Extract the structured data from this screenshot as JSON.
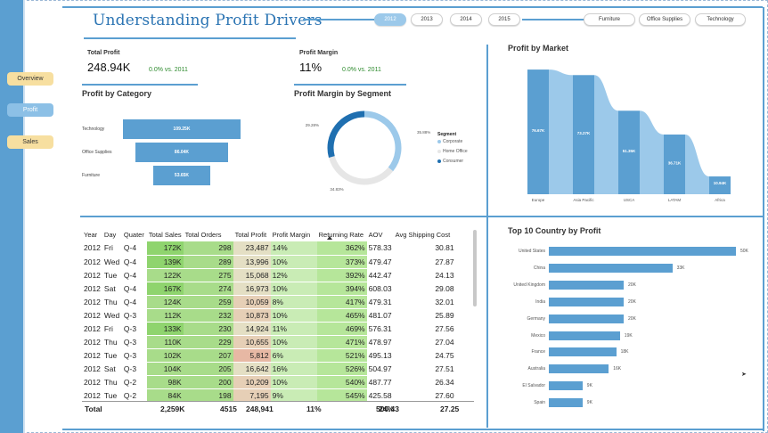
{
  "nav": {
    "overview": "Overview",
    "profit": "Profit",
    "sales": "Sales"
  },
  "title": "Understanding  Profit Drivers",
  "year_filters": [
    "2012",
    "2013",
    "2014",
    "2015"
  ],
  "year_active": "2012",
  "category_filters": [
    "Furniture",
    "Office Supplies",
    "Technology"
  ],
  "kpi": {
    "total_profit_label": "Total Profit",
    "total_profit_value": "248.94K",
    "total_profit_delta": "0.0% vs. 2011",
    "profit_margin_label": "Profit Margin",
    "profit_margin_value": "11%",
    "profit_margin_delta": "0.0% vs. 2011"
  },
  "colors": {
    "accent": "#5b9fd1",
    "accent_light": "#9cc9ea",
    "home_office": "#e6e6e6",
    "consumer": "#1f6fb0"
  },
  "profit_by_category": {
    "title": "Profit by Category",
    "items": [
      {
        "label": "Technology",
        "value": "109.25K",
        "num": 109.25
      },
      {
        "label": "Office Supplies",
        "value": "86.04K",
        "num": 86.04
      },
      {
        "label": "Furniture",
        "value": "53.65K",
        "num": 53.65
      }
    ]
  },
  "profit_margin_by_segment": {
    "title": "Profit Margin by Segment",
    "legend_title": "Segment",
    "segments": [
      {
        "label": "Corporate",
        "value": "35.88%",
        "num": 35.88
      },
      {
        "label": "Home Office",
        "value": "34.83%",
        "num": 34.83
      },
      {
        "label": "Consumer",
        "value": "29.28%",
        "num": 29.28
      }
    ]
  },
  "profit_by_market": {
    "title": "Profit by Market",
    "markets": [
      {
        "label": "Europe",
        "value": "76.67K",
        "num": 76.67
      },
      {
        "label": "Asia Pacific",
        "value": "73.27K",
        "num": 73.27
      },
      {
        "label": "USCA",
        "value": "51.35K",
        "num": 51.35
      },
      {
        "label": "LATAM",
        "value": "36.71K",
        "num": 36.71
      },
      {
        "label": "Africa",
        "value": "10.94K",
        "num": 10.94
      }
    ]
  },
  "top_countries": {
    "title": "Top 10 Country by Profit",
    "countries": [
      {
        "label": "United States",
        "value": "50K",
        "num": 50
      },
      {
        "label": "China",
        "value": "33K",
        "num": 33
      },
      {
        "label": "United Kingdom",
        "value": "20K",
        "num": 20
      },
      {
        "label": "India",
        "value": "20K",
        "num": 20
      },
      {
        "label": "Germany",
        "value": "20K",
        "num": 20
      },
      {
        "label": "Mexico",
        "value": "19K",
        "num": 19
      },
      {
        "label": "France",
        "value": "18K",
        "num": 18
      },
      {
        "label": "Australia",
        "value": "16K",
        "num": 16
      },
      {
        "label": "El Salvador",
        "value": "9K",
        "num": 9
      },
      {
        "label": "Spain",
        "value": "9K",
        "num": 9
      }
    ]
  },
  "table": {
    "headers": [
      "Year",
      "Day",
      "Quater",
      "Total Sales",
      "Total Orders",
      "Total Profit",
      "Profit Margin",
      "Returning Rate",
      "AOV",
      "Avg Shipping Cost"
    ],
    "rows": [
      [
        "2012",
        "Fri",
        "Q-4",
        "172K",
        "298",
        "23,487",
        "14%",
        "362%",
        "578.33",
        "30.81"
      ],
      [
        "2012",
        "Wed",
        "Q-4",
        "139K",
        "289",
        "13,996",
        "10%",
        "373%",
        "479.47",
        "27.87"
      ],
      [
        "2012",
        "Tue",
        "Q-4",
        "122K",
        "275",
        "15,068",
        "12%",
        "392%",
        "442.47",
        "24.13"
      ],
      [
        "2012",
        "Sat",
        "Q-4",
        "167K",
        "274",
        "16,973",
        "10%",
        "394%",
        "608.03",
        "29.08"
      ],
      [
        "2012",
        "Thu",
        "Q-4",
        "124K",
        "259",
        "10,059",
        "8%",
        "417%",
        "479.31",
        "32.01"
      ],
      [
        "2012",
        "Wed",
        "Q-3",
        "112K",
        "232",
        "10,873",
        "10%",
        "465%",
        "481.07",
        "25.89"
      ],
      [
        "2012",
        "Fri",
        "Q-3",
        "133K",
        "230",
        "14,924",
        "11%",
        "469%",
        "576.31",
        "27.56"
      ],
      [
        "2012",
        "Thu",
        "Q-3",
        "110K",
        "229",
        "10,655",
        "10%",
        "471%",
        "478.97",
        "27.04"
      ],
      [
        "2012",
        "Tue",
        "Q-3",
        "102K",
        "207",
        "5,812",
        "6%",
        "521%",
        "495.13",
        "24.75"
      ],
      [
        "2012",
        "Sat",
        "Q-3",
        "104K",
        "205",
        "16,642",
        "16%",
        "526%",
        "504.97",
        "27.51"
      ],
      [
        "2012",
        "Thu",
        "Q-2",
        "98K",
        "200",
        "10,209",
        "10%",
        "540%",
        "487.77",
        "26.34"
      ],
      [
        "2012",
        "Tue",
        "Q-2",
        "84K",
        "198",
        "7,195",
        "9%",
        "545%",
        "425.58",
        "27.60"
      ]
    ],
    "total": {
      "label": "Total",
      "sales": "2,259K",
      "orders": "4515",
      "profit": "248,941",
      "margin": "11%",
      "returning": "24%",
      "aov": "500.43",
      "shipping": "27.25"
    }
  }
}
